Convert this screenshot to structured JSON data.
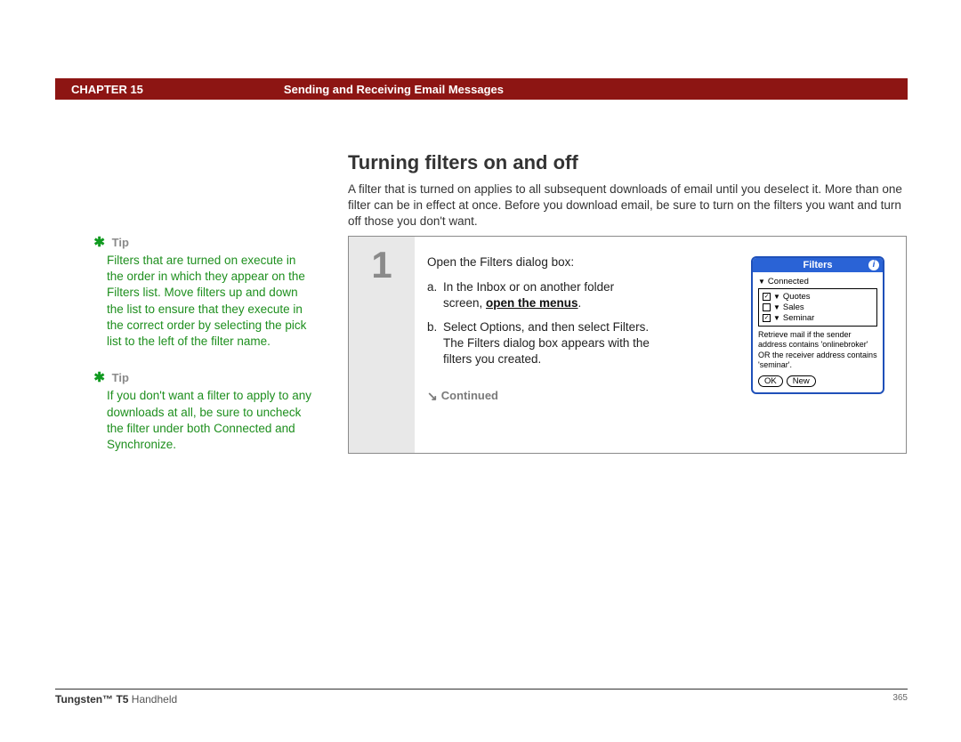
{
  "header": {
    "chapter": "CHAPTER 15",
    "title": "Sending and Receiving Email Messages"
  },
  "main": {
    "heading": "Turning filters on and off",
    "intro": "A filter that is turned on applies to all subsequent downloads of email until you deselect it. More than one filter can be in effect at once. Before you download email, be sure to turn on the filters you want and turn off those you don't want."
  },
  "tips": [
    {
      "label": "Tip",
      "body": "Filters that are turned on execute in the order in which they appear on the Filters list. Move filters up and down the list to ensure that they execute in the correct order by selecting the pick list to the left of the filter name."
    },
    {
      "label": "Tip",
      "body": "If you don't want a filter to apply to any downloads at all, be sure to uncheck the filter under both Connected and Synchronize."
    }
  ],
  "step": {
    "num": "1",
    "lead": "Open the Filters dialog box:",
    "items": [
      {
        "lbl": "a.",
        "pre": "In the Inbox or on another folder screen, ",
        "link": "open the menus",
        "post": "."
      },
      {
        "lbl": "b.",
        "pre": "Select Options, and then select Filters. The Filters dialog box appears with the filters you created.",
        "link": "",
        "post": ""
      }
    ],
    "continued": "Continued"
  },
  "dialog": {
    "title": "Filters",
    "mode": "Connected",
    "filters": [
      {
        "name": "Quotes",
        "checked": true
      },
      {
        "name": "Sales",
        "checked": false
      },
      {
        "name": "Seminar",
        "checked": true
      }
    ],
    "desc": "Retrieve mail if the sender address contains 'onlinebroker' OR the receiver address contains 'seminar'.",
    "buttons": {
      "ok": "OK",
      "new": "New"
    }
  },
  "footer": {
    "product_bold": "Tungsten™ T5",
    "product_rest": " Handheld",
    "page": "365"
  }
}
